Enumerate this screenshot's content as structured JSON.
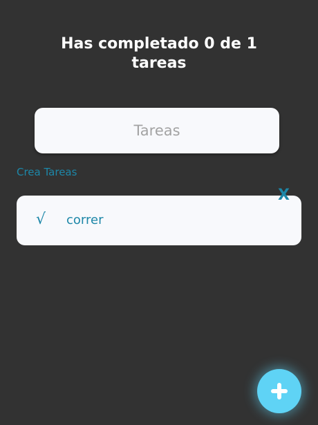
{
  "header": {
    "title": "Has completado 0 de 1 tareas"
  },
  "input": {
    "placeholder": "Tareas",
    "value": ""
  },
  "create_label": "Crea Tareas",
  "tasks": [
    {
      "check_glyph": "√",
      "text": "correr",
      "delete_glyph": "X"
    }
  ],
  "fab": {
    "icon": "plus-icon"
  },
  "colors": {
    "background": "#323232",
    "card": "#f8f9fc",
    "accent": "#1d87a8",
    "fab": "#5fd3f5"
  }
}
